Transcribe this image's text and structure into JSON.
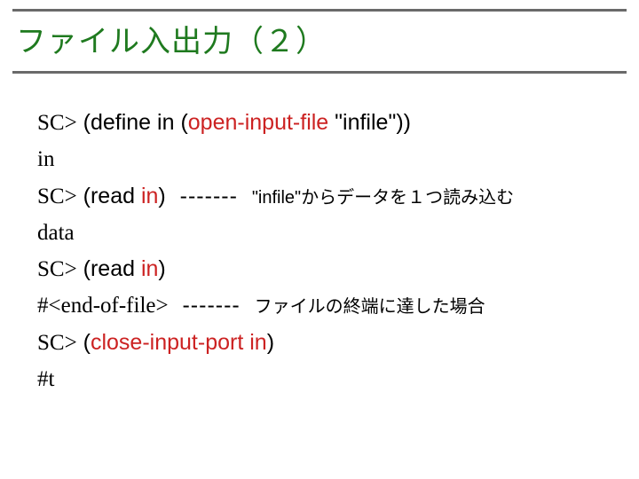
{
  "title": "ファイル入出力（２）",
  "lines": {
    "l1_prompt": "SC>",
    "l1_a": " (",
    "l1_b": "define in ",
    "l1_c": "(",
    "l1_d": "open-input-file ",
    "l1_e": "\"infile\"",
    "l1_f": "))",
    "l2": "in",
    "l3_prompt": "SC>",
    "l3_a": " (",
    "l3_b": "read ",
    "l3_c": "in",
    "l3_d": ")",
    "l3_dash": "  -------  ",
    "l3_note": "\"infile\"からデータを１つ読み込む",
    "l4": "data",
    "l5_prompt": "SC>",
    "l5_a": " (",
    "l5_b": "read ",
    "l5_c": "in",
    "l5_d": ")",
    "l6": "#<end-of-file>",
    "l6_dash": "  -------  ",
    "l6_note": "ファイルの終端に達した場合",
    "l7_prompt": "SC>",
    "l7_a": " (",
    "l7_b": "close-input-port in",
    "l7_c": ")",
    "l8": "#t"
  }
}
